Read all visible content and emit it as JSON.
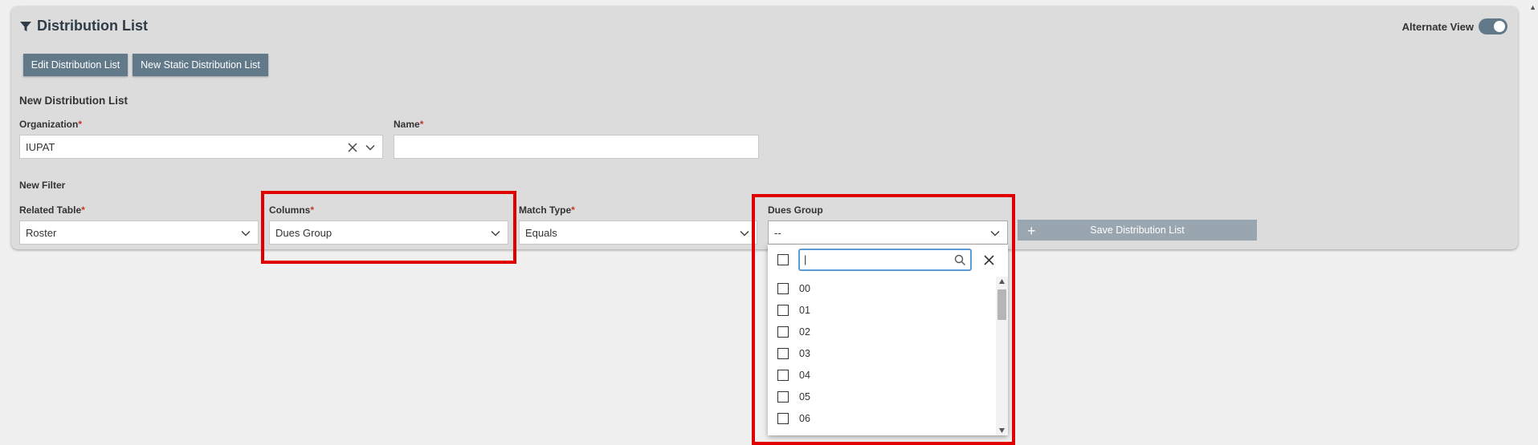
{
  "header": {
    "title": "Distribution List",
    "alt_view_label": "Alternate View",
    "alt_view_on": true
  },
  "toolbar": {
    "edit_label": "Edit Distribution List",
    "new_static_label": "New Static Distribution List"
  },
  "new_list": {
    "section_title": "New Distribution List",
    "organization": {
      "label": "Organization",
      "value": "IUPAT"
    },
    "name": {
      "label": "Name",
      "value": ""
    }
  },
  "filter": {
    "section_title": "New Filter",
    "related_table": {
      "label": "Related Table",
      "value": "Roster"
    },
    "columns": {
      "label": "Columns",
      "value": "Dues Group"
    },
    "match_type": {
      "label": "Match Type",
      "value": "Equals"
    },
    "dues_group": {
      "label": "Dues Group",
      "value": "--"
    },
    "save_label": "Save Distribution List"
  },
  "dropdown": {
    "search_value": "|",
    "options": [
      "00",
      "01",
      "02",
      "03",
      "04",
      "05",
      "06"
    ]
  },
  "required_mark": "*",
  "colors": {
    "accent": "#62798a",
    "highlight": "#e00000",
    "focus": "#5b9bd5"
  }
}
